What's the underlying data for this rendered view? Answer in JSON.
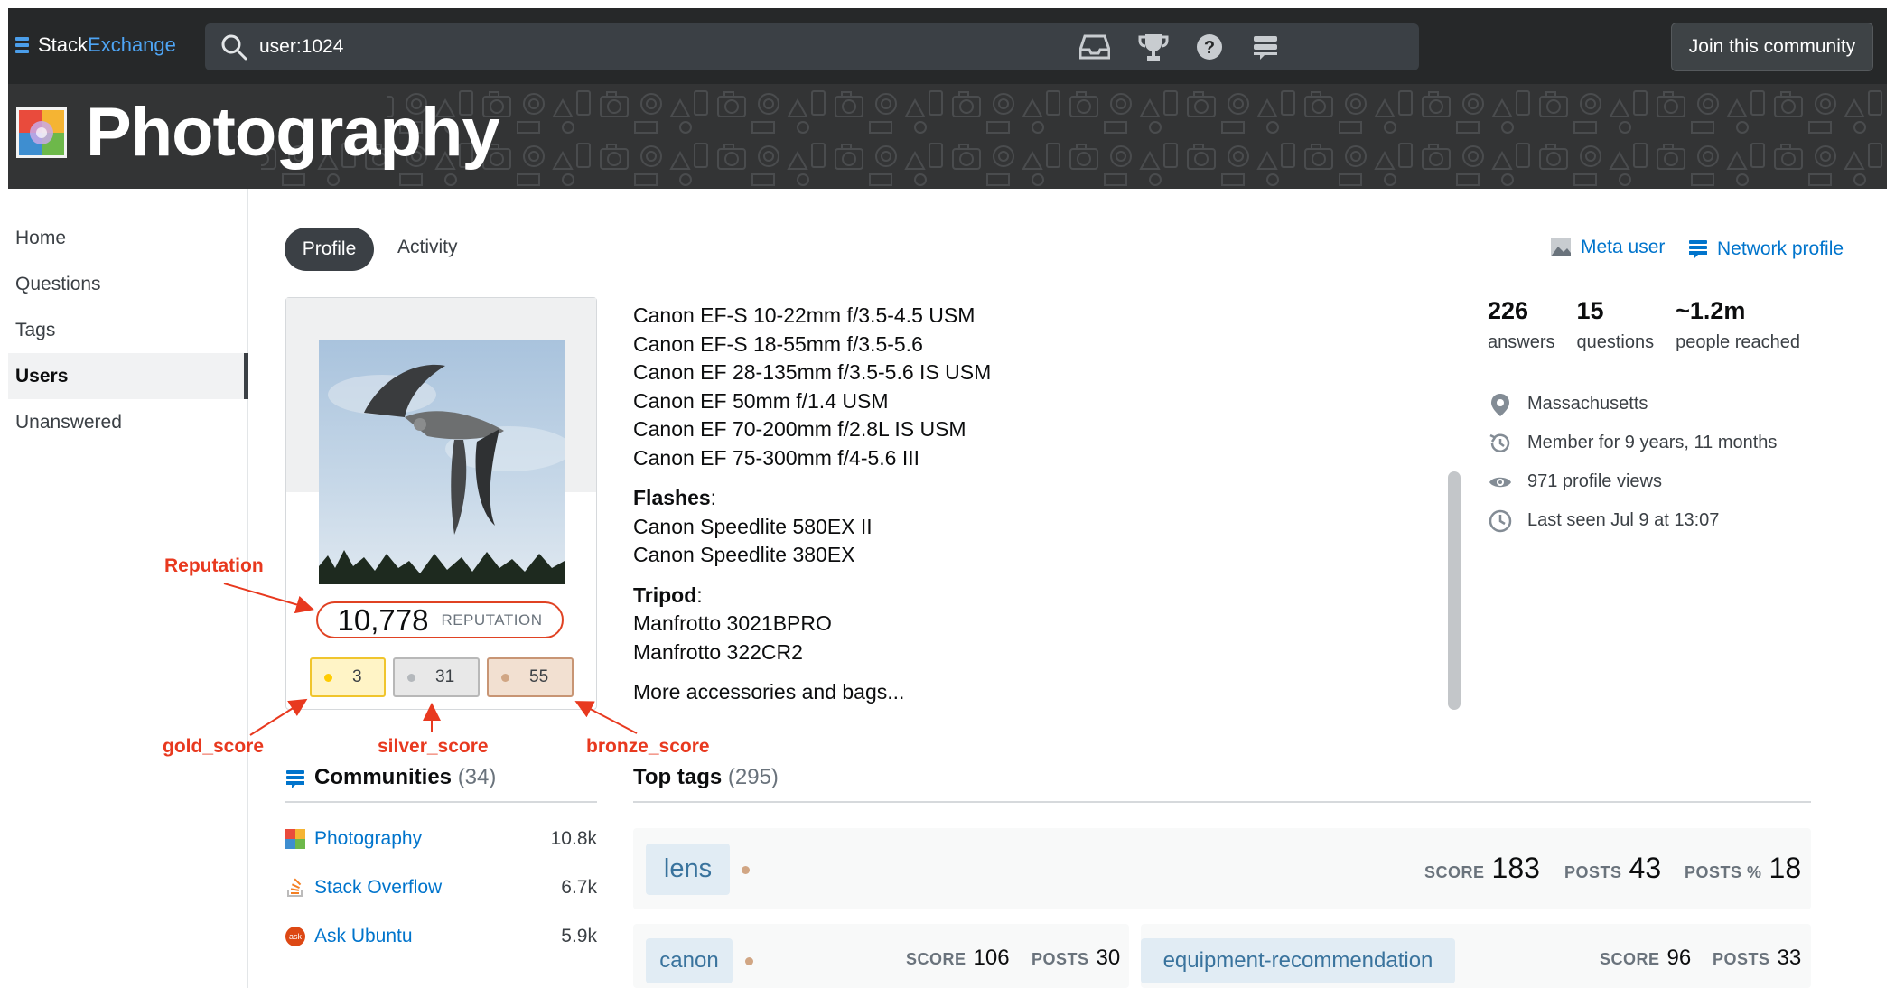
{
  "topbar": {
    "brand_part1": "Stack",
    "brand_part2": "Exchange",
    "search_value": "user:1024",
    "join_label": "Join this community"
  },
  "site": {
    "title": "Photography"
  },
  "leftnav": {
    "items": [
      {
        "label": "Home"
      },
      {
        "label": "Questions"
      },
      {
        "label": "Tags"
      },
      {
        "label": "Users",
        "active": true
      },
      {
        "label": "Unanswered"
      }
    ]
  },
  "tabs": {
    "profile": "Profile",
    "activity": "Activity"
  },
  "links": {
    "meta_user": "Meta user",
    "network_profile": "Network profile"
  },
  "card": {
    "reputation_value": "10,778",
    "reputation_label": "REPUTATION",
    "gold": "3",
    "silver": "31",
    "bronze": "55"
  },
  "annotations": {
    "reputation": "Reputation",
    "gold": "gold_score",
    "silver": "silver_score",
    "bronze": "bronze_score"
  },
  "about": {
    "lenses": [
      "Canon EF-S 10-22mm f/3.5-4.5 USM",
      "Canon EF-S 18-55mm f/3.5-5.6",
      "Canon EF 28-135mm f/3.5-5.6 IS USM",
      "Canon EF 50mm f/1.4 USM",
      "Canon EF 70-200mm f/2.8L IS USM",
      "Canon EF 75-300mm f/4-5.6 III"
    ],
    "flashes_label": "Flashes",
    "flashes": [
      "Canon Speedlite 580EX II",
      "Canon Speedlite 380EX"
    ],
    "tripod_label": "Tripod",
    "tripods": [
      "Manfrotto 3021BPRO",
      "Manfrotto 322CR2"
    ],
    "more": "More accessories and bags...",
    "colon": ":"
  },
  "stats": {
    "answers_value": "226",
    "answers_label": "answers",
    "questions_value": "15",
    "questions_label": "questions",
    "reached_value": "~1.2m",
    "reached_label": "people reached"
  },
  "meta": {
    "location": "Massachusetts",
    "member_for": "Member for 9 years, 11 months",
    "profile_views": "971 profile views",
    "last_seen": "Last seen Jul 9 at 13:07"
  },
  "communities": {
    "title": "Communities",
    "count": "(34)",
    "items": [
      {
        "name": "Photography",
        "value": "10.8k"
      },
      {
        "name": "Stack Overflow",
        "value": "6.7k"
      },
      {
        "name": "Ask Ubuntu",
        "value": "5.9k"
      }
    ]
  },
  "top_tags": {
    "title": "Top tags",
    "count": "(295)",
    "score_label": "SCORE",
    "posts_label": "POSTS",
    "posts_pct_label": "POSTS %",
    "items": [
      {
        "name": "lens",
        "score": "183",
        "posts": "43",
        "posts_pct": "18"
      },
      {
        "name": "canon",
        "score": "106",
        "posts": "30"
      },
      {
        "name": "equipment-recommendation",
        "score": "96",
        "posts": "33"
      }
    ]
  },
  "colors": {
    "accent_link": "#0074cc",
    "annotation": "#e8391f",
    "topbar": "#262829"
  }
}
